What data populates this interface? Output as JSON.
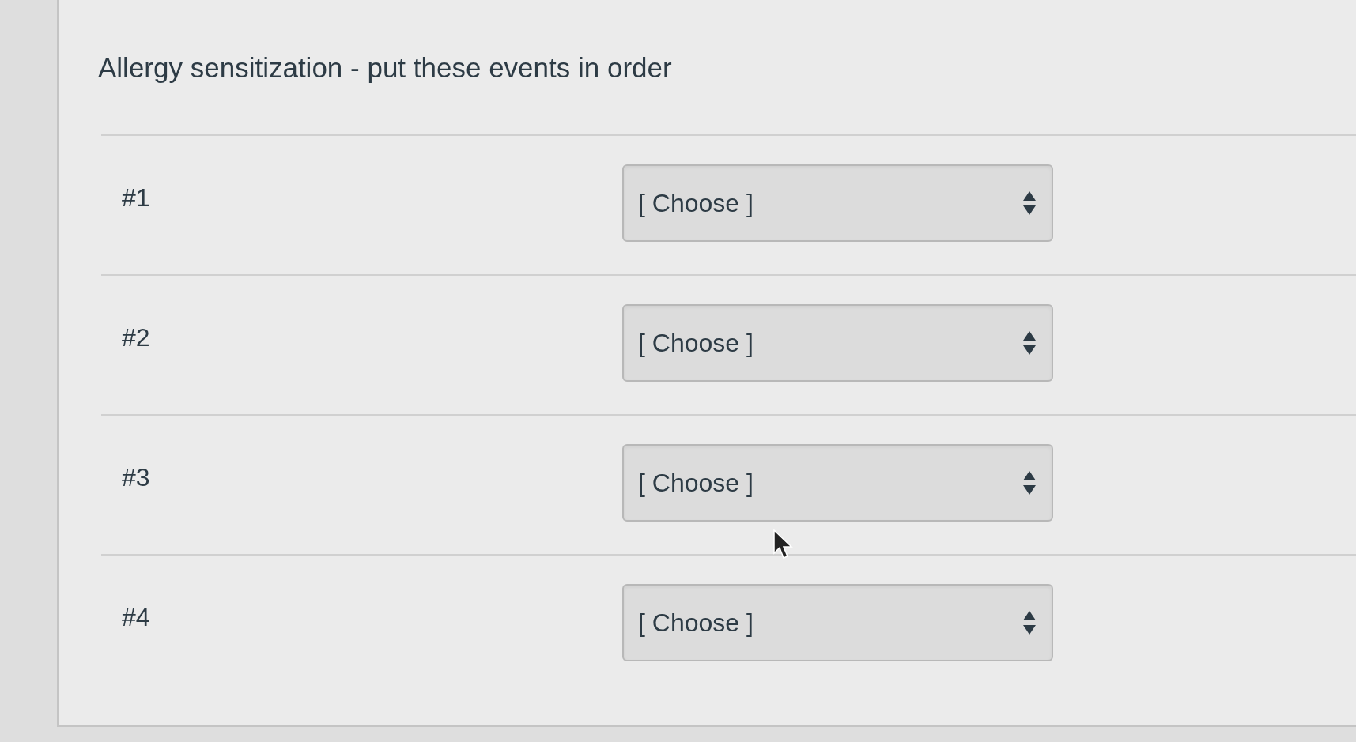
{
  "title": "Allergy sensitization - put these events in order",
  "items": [
    {
      "label": "#1",
      "dropdown": {
        "value": "[ Choose ]"
      }
    },
    {
      "label": "#2",
      "dropdown": {
        "value": "[ Choose ]"
      }
    },
    {
      "label": "#3",
      "dropdown": {
        "value": "[ Choose ]"
      }
    },
    {
      "label": "#4",
      "dropdown": {
        "value": "[ Choose ]"
      }
    }
  ]
}
